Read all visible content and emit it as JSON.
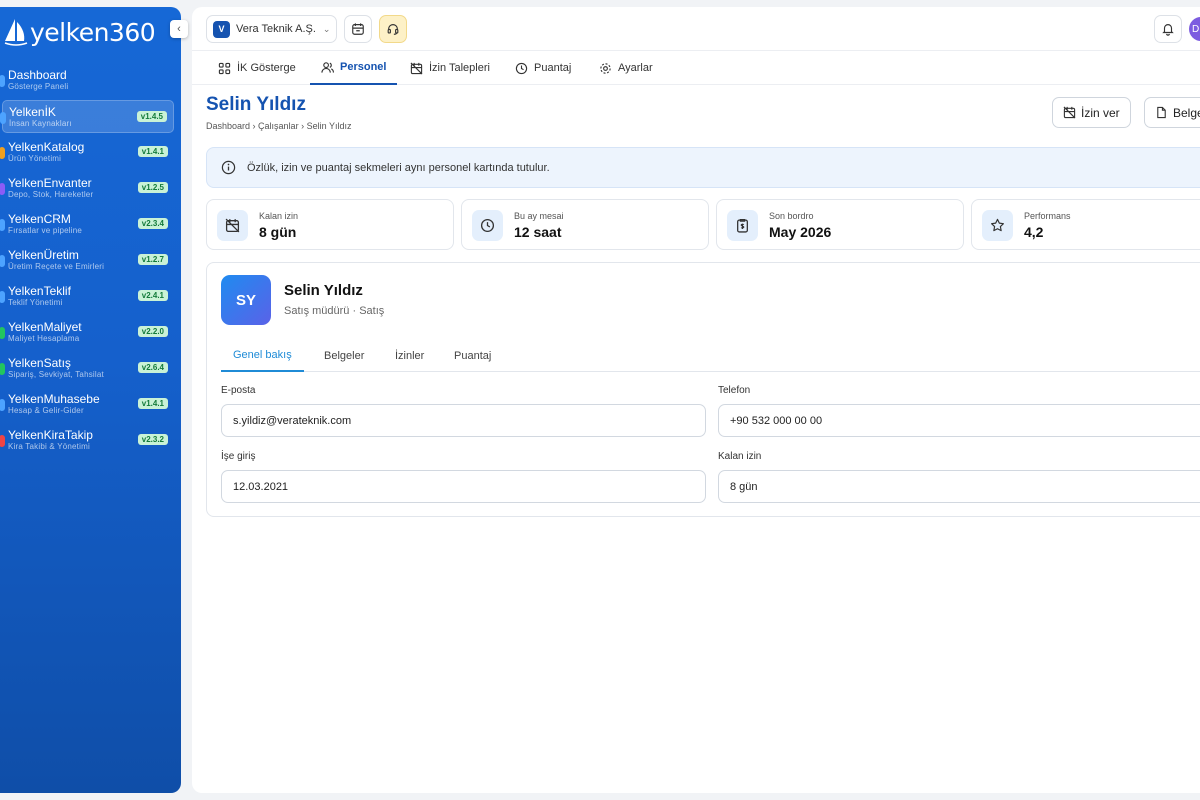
{
  "brand": {
    "logo_text": "yelken360"
  },
  "sidebar": {
    "items": [
      {
        "title": "Dashboard",
        "subtitle": "Gösterge Paneli",
        "version": "",
        "dot_color": "#4da3ff",
        "active": false
      },
      {
        "title": "YelkenİK",
        "subtitle": "İnsan Kaynakları",
        "version": "v1.4.5",
        "dot_color": "#4da3ff",
        "active": true
      },
      {
        "title": "YelkenKatalog",
        "subtitle": "Ürün Yönetimi",
        "version": "v1.4.1",
        "dot_color": "#f0a020",
        "active": false
      },
      {
        "title": "YelkenEnvanter",
        "subtitle": "Depo, Stok, Hareketler",
        "version": "v1.2.5",
        "dot_color": "#8b5cf6",
        "active": false
      },
      {
        "title": "YelkenCRM",
        "subtitle": "Fırsatlar ve pipeline",
        "version": "v2.3.4",
        "dot_color": "#4da3ff",
        "active": false
      },
      {
        "title": "YelkenÜretim",
        "subtitle": "Üretim Reçete ve Emirleri",
        "version": "v1.2.7",
        "dot_color": "#4da3ff",
        "active": false
      },
      {
        "title": "YelkenTeklif",
        "subtitle": "Teklif Yönetimi",
        "version": "v2.4.1",
        "dot_color": "#4da3ff",
        "active": false
      },
      {
        "title": "YelkenMaliyet",
        "subtitle": "Maliyet Hesaplama",
        "version": "v2.2.0",
        "dot_color": "#22c55e",
        "active": false
      },
      {
        "title": "YelkenSatış",
        "subtitle": "Sipariş, Sevkiyat, Tahsilat",
        "version": "v2.6.4",
        "dot_color": "#22c55e",
        "active": false
      },
      {
        "title": "YelkenMuhasebe",
        "subtitle": "Hesap & Gelir-Gider",
        "version": "v1.4.1",
        "dot_color": "#4da3ff",
        "active": false
      },
      {
        "title": "YelkenKiraTakip",
        "subtitle": "Kira Takibi & Yönetimi",
        "version": "v2.3.2",
        "dot_color": "#ef4444",
        "active": false
      }
    ]
  },
  "topbar": {
    "company_initial": "V",
    "company_name": "Vera Teknik A.Ş.",
    "user_initial": "D"
  },
  "tabs": [
    {
      "label": "İK Gösterge",
      "icon": "grid-icon"
    },
    {
      "label": "Personel",
      "icon": "users-icon"
    },
    {
      "label": "İzin Talepleri",
      "icon": "calendar-off-icon"
    },
    {
      "label": "Puantaj",
      "icon": "clock-icon"
    },
    {
      "label": "Ayarlar",
      "icon": "gear-icon"
    }
  ],
  "page": {
    "title": "Selin Yıldız",
    "breadcrumb": [
      "Dashboard",
      "Çalışanlar",
      "Selin Yıldız"
    ],
    "actions": {
      "leave": "İzin ver",
      "docs": "Belge"
    }
  },
  "info_text": "Özlük, izin ve puantaj sekmeleri aynı personel kartında tutulur.",
  "stats": [
    {
      "label": "Kalan izin",
      "value": "8 gün",
      "icon": "calendar-off-icon"
    },
    {
      "label": "Bu ay mesai",
      "value": "12 saat",
      "icon": "clock-icon"
    },
    {
      "label": "Son bordro",
      "value": "May 2026",
      "icon": "payslip-icon"
    },
    {
      "label": "Performans",
      "value": "4,2",
      "icon": "star-icon"
    }
  ],
  "profile": {
    "initials": "SY",
    "name": "Selin Yıldız",
    "role": "Satış müdürü · Satış",
    "subtabs": [
      "Genel bakış",
      "Belgeler",
      "İzinler",
      "Puantaj"
    ],
    "fields": [
      {
        "label": "E-posta",
        "value": "s.yildiz@verateknik.com"
      },
      {
        "label": "Telefon",
        "value": "+90 532 000 00 00"
      },
      {
        "label": "İşe giriş",
        "value": "12.03.2021"
      },
      {
        "label": "Kalan izin",
        "value": "8 gün"
      }
    ]
  },
  "colors": {
    "primary": "#1553b0",
    "accent": "#1f8bd6",
    "version_badge_bg": "#c9f2d6"
  }
}
